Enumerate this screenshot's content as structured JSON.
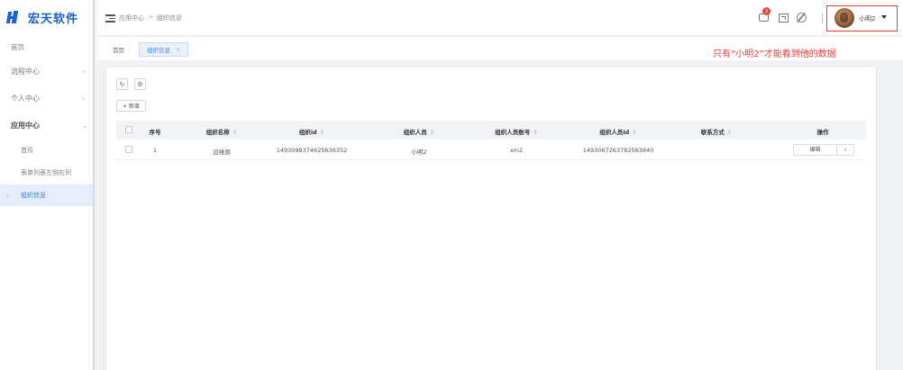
{
  "app": {
    "logo_text": "宏天软件"
  },
  "sidebar": {
    "items": [
      {
        "label": "首页"
      },
      {
        "label": "流程中心"
      },
      {
        "label": "个人中心"
      },
      {
        "label": "应用中心"
      },
      {
        "label": "首页"
      },
      {
        "label": "表单列表左侧右列"
      },
      {
        "label": "组织信息"
      }
    ]
  },
  "header": {
    "breadcrumb": [
      "应用中心",
      "组织信息"
    ],
    "breadcrumb_sep": ">",
    "message_badge": "2",
    "user_name": "小明2"
  },
  "tabs": [
    {
      "label": "首页"
    },
    {
      "label": "组织信息",
      "close": "×"
    }
  ],
  "annotation": "只有“小明2”才能看到他的数据",
  "toolbar": {
    "add_label": "+ 新增"
  },
  "table": {
    "columns": [
      "序号",
      "组织名称",
      "组织id",
      "组织人员",
      "组织人员账号",
      "组织人员id",
      "联系方式",
      "操作"
    ],
    "sort_glyph": "⇕",
    "rows": [
      {
        "index": "1",
        "org_name": "运维部",
        "org_id": "1493098374625636352",
        "member": "小明2",
        "account": "xm2",
        "member_id": "1493067263782563840",
        "contact": "",
        "edit_label": "编辑",
        "dropdown": "∨"
      }
    ]
  },
  "colors": {
    "accent": "#3b7ae0",
    "highlight": "#e43f33",
    "badge": "#e14a3f"
  }
}
